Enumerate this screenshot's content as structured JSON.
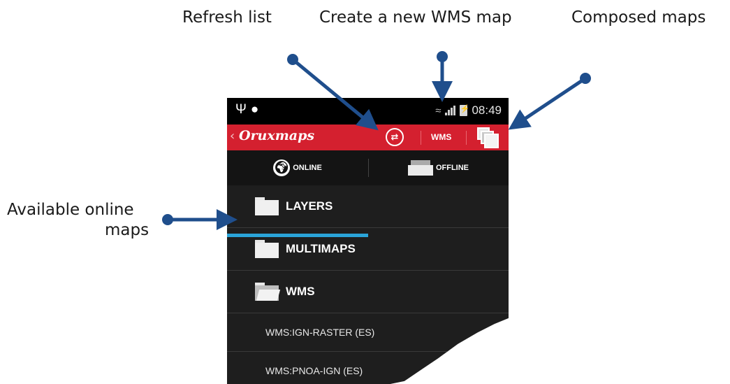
{
  "callouts": {
    "refresh": "Refresh list",
    "create_wms": "Create a new WMS map",
    "composed": "Composed maps",
    "available_line1": "Available online",
    "available_line2": "maps"
  },
  "colors": {
    "arrow": "#1f4e8c",
    "appbar": "#d4202f",
    "tab_indicator": "#2aa4d9",
    "list_bg": "#1e1e1e"
  },
  "phone": {
    "status_bar": {
      "left_icons": [
        "usb-icon",
        "notification-icon"
      ],
      "right_icons": [
        "wifi-icon",
        "signal-icon",
        "battery-charging-icon"
      ],
      "time": "08:49"
    },
    "app_bar": {
      "back_glyph": "‹",
      "title_bold": "Oruxmaps",
      "actions": {
        "refresh_icon": "refresh-icon",
        "wms_label": "WMS",
        "composed_icon": "layers-icon"
      }
    },
    "tabs": [
      {
        "label": "ONLINE",
        "icon": "globe-icon",
        "selected": true
      },
      {
        "label": "OFFLINE",
        "icon": "tray-icon",
        "selected": false
      }
    ],
    "list": {
      "folders": [
        {
          "label": "LAYERS",
          "icon": "folder-icon"
        },
        {
          "label": "MULTIMAPS",
          "icon": "folder-icon"
        },
        {
          "label": "WMS",
          "icon": "folder-open-icon"
        }
      ],
      "items": [
        {
          "label": "WMS:IGN-RASTER (ES)"
        },
        {
          "label": "WMS:PNOA-IGN (ES)"
        }
      ]
    }
  }
}
